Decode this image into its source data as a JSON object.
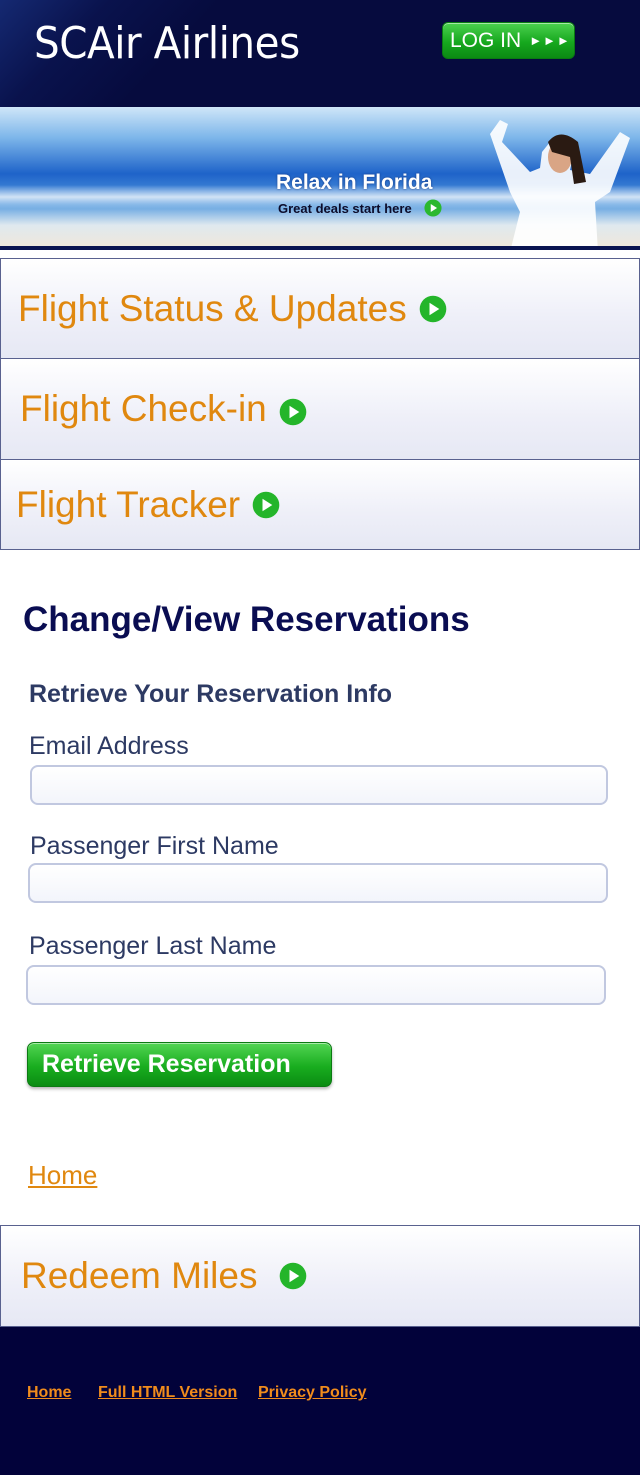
{
  "header": {
    "logo_text": "SCAir Airlines",
    "login_label": "LOG IN",
    "login_arrows": "►►►"
  },
  "banner": {
    "title": "Relax in Florida",
    "subtitle": "Great deals start here"
  },
  "nav": {
    "flight_status": "Flight Status & Updates",
    "check_in": "Flight Check-in",
    "tracker": "Flight Tracker",
    "redeem": "Redeem Miles"
  },
  "main": {
    "section_title": "Change/View Reservations",
    "form_heading": "Retrieve Your Reservation Info",
    "fields": {
      "email_label": "Email Address",
      "email_value": "",
      "first_name_label": "Passenger First Name",
      "first_name_value": "",
      "last_name_label": "Passenger Last Name",
      "last_name_value": ""
    },
    "submit_label": "Retrieve Reservation",
    "home_link": "Home"
  },
  "footer": {
    "home": "Home",
    "full_html": "Full HTML Version",
    "privacy": "Privacy Policy"
  },
  "colors": {
    "header_bg": "#060b3e",
    "accent_orange": "#e0880f",
    "title_navy": "#0a0d52",
    "button_green": "#19ad1f"
  },
  "icons": {
    "go": "green-play-circle-icon"
  }
}
